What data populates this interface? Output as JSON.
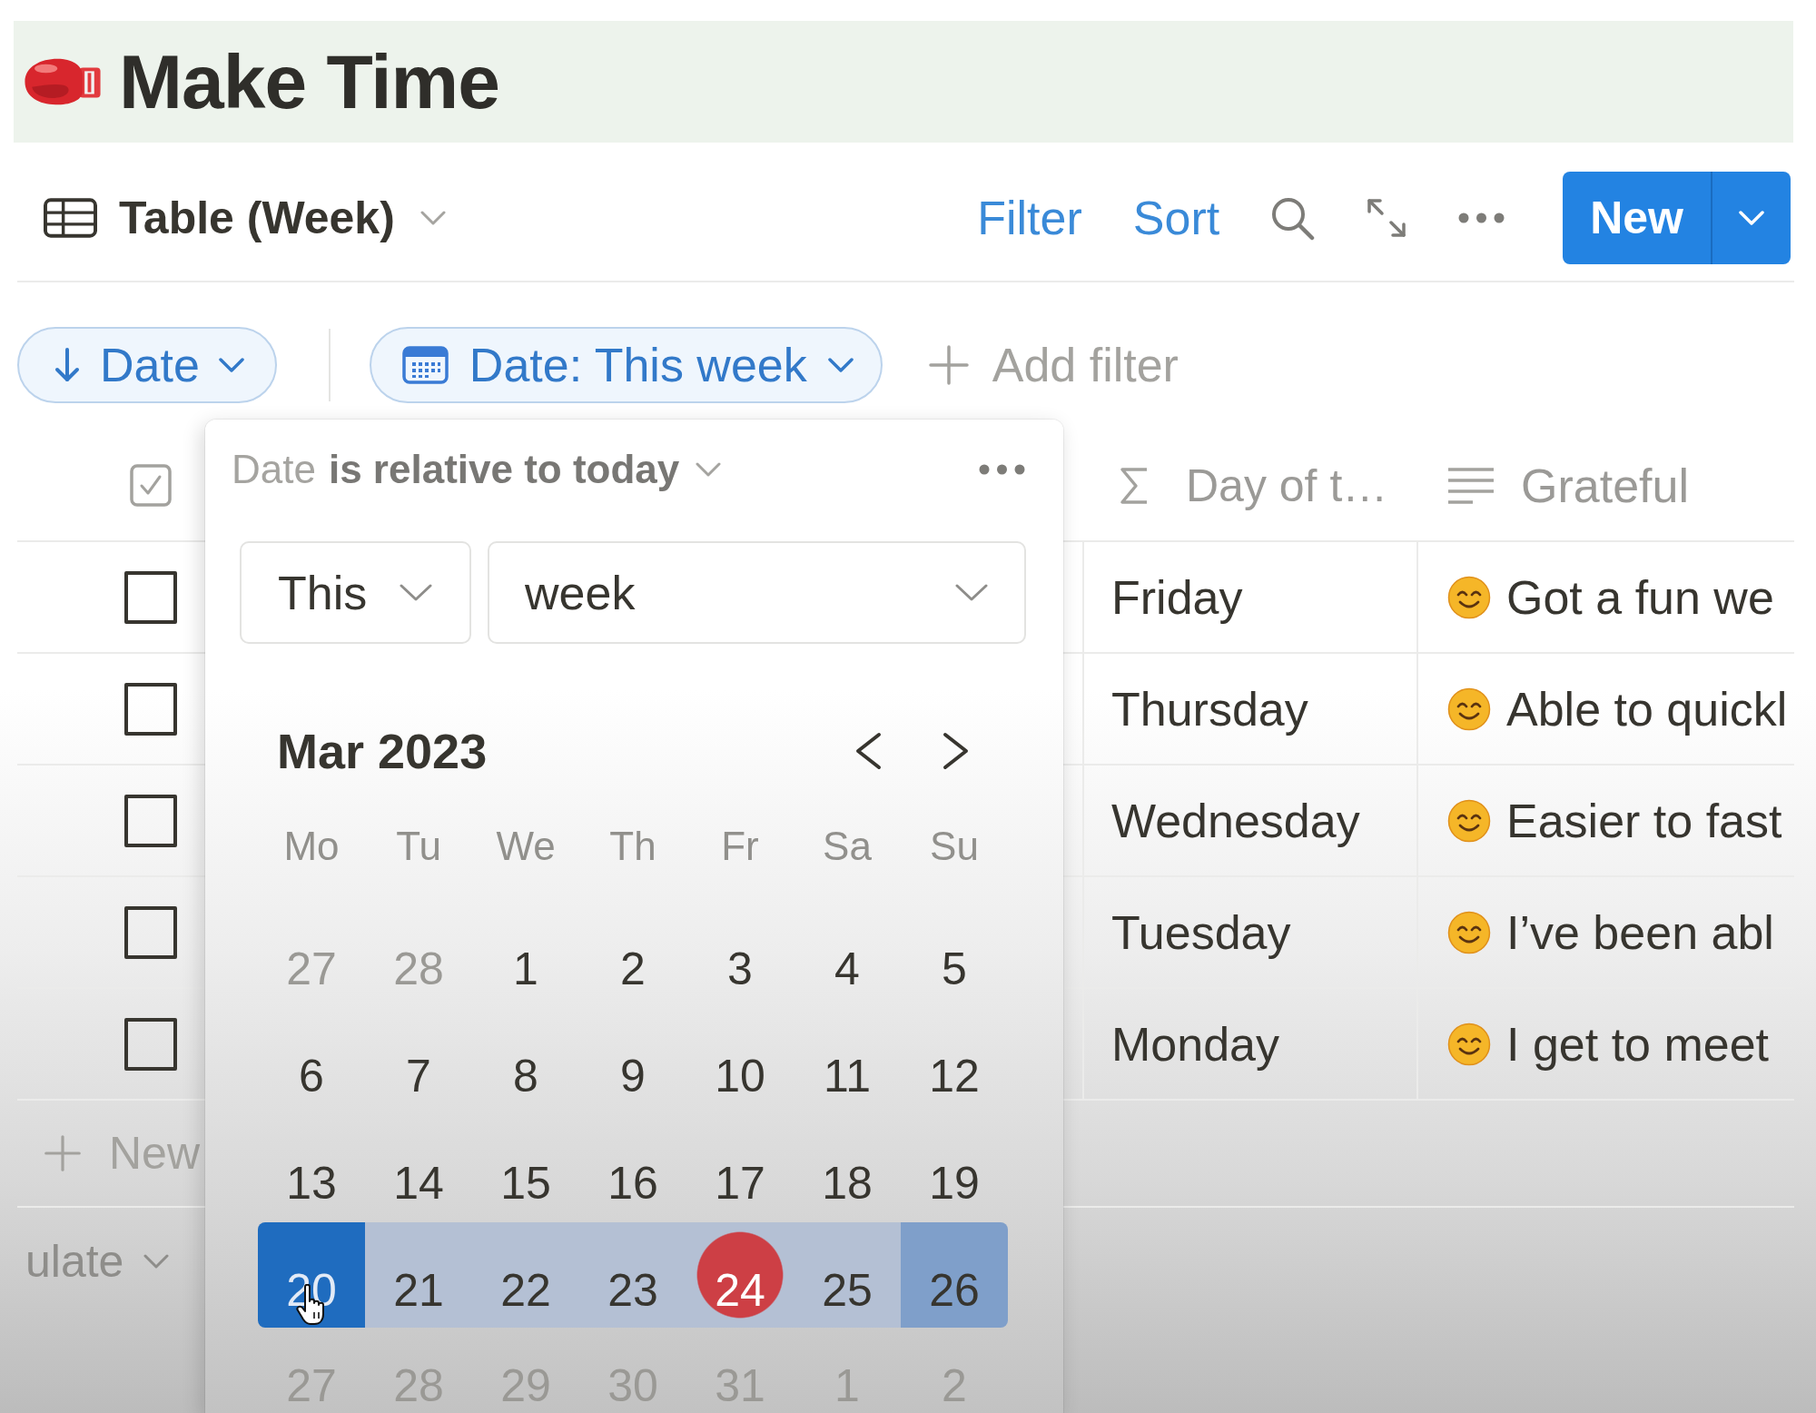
{
  "page": {
    "title": "Make Time"
  },
  "view_bar": {
    "view_name": "Table (Week)",
    "actions": [
      {
        "label": "Filter"
      },
      {
        "label": "Sort"
      }
    ],
    "new_button": "New"
  },
  "filter_bar": {
    "sort_pill": "Date",
    "filter_pill": "Date: This week",
    "add_filter": "Add filter"
  },
  "table": {
    "columns": [
      {
        "kind": "checkbox"
      },
      {
        "kind": "formula",
        "label": "Day of t…"
      },
      {
        "kind": "text",
        "label": "Grateful"
      }
    ],
    "rows": [
      {
        "checked": false,
        "day": "Friday",
        "grateful": "Got a fun we"
      },
      {
        "checked": false,
        "day": "Thursday",
        "grateful": "Able to quickl"
      },
      {
        "checked": false,
        "day": "Wednesday",
        "grateful": "Easier to fast"
      },
      {
        "checked": false,
        "day": "Tuesday",
        "grateful": "I’ve been abl"
      },
      {
        "checked": false,
        "day": "Monday",
        "grateful": "I get to meet"
      }
    ],
    "new_row": "New",
    "calculate": "ulate"
  },
  "filter_popup": {
    "property": "Date",
    "condition": "is relative to today",
    "relation": "This",
    "unit": "week",
    "calendar": {
      "month": "Mar 2023",
      "weekdays": [
        "Mo",
        "Tu",
        "We",
        "Th",
        "Fr",
        "Sa",
        "Su"
      ],
      "weeks": [
        {
          "days": [
            {
              "label": "27",
              "muted": true,
              "selected": false,
              "today": false,
              "hovered": false
            },
            {
              "label": "28",
              "muted": true,
              "selected": false,
              "today": false,
              "hovered": false
            },
            {
              "label": "1",
              "muted": false,
              "selected": false,
              "today": false,
              "hovered": false
            },
            {
              "label": "2",
              "muted": false,
              "selected": false,
              "today": false,
              "hovered": false
            },
            {
              "label": "3",
              "muted": false,
              "selected": false,
              "today": false,
              "hovered": false
            },
            {
              "label": "4",
              "muted": false,
              "selected": false,
              "today": false,
              "hovered": false
            },
            {
              "label": "5",
              "muted": false,
              "selected": false,
              "today": false,
              "hovered": false
            }
          ]
        },
        {
          "days": [
            {
              "label": "6",
              "muted": false,
              "selected": false,
              "today": false,
              "hovered": false
            },
            {
              "label": "7",
              "muted": false,
              "selected": false,
              "today": false,
              "hovered": false
            },
            {
              "label": "8",
              "muted": false,
              "selected": false,
              "today": false,
              "hovered": false
            },
            {
              "label": "9",
              "muted": false,
              "selected": false,
              "today": false,
              "hovered": false
            },
            {
              "label": "10",
              "muted": false,
              "selected": false,
              "today": false,
              "hovered": false
            },
            {
              "label": "11",
              "muted": false,
              "selected": false,
              "today": false,
              "hovered": false
            },
            {
              "label": "12",
              "muted": false,
              "selected": false,
              "today": false,
              "hovered": false
            }
          ]
        },
        {
          "days": [
            {
              "label": "13",
              "muted": false,
              "selected": false,
              "today": false,
              "hovered": false
            },
            {
              "label": "14",
              "muted": false,
              "selected": false,
              "today": false,
              "hovered": false
            },
            {
              "label": "15",
              "muted": false,
              "selected": false,
              "today": false,
              "hovered": false
            },
            {
              "label": "16",
              "muted": false,
              "selected": false,
              "today": false,
              "hovered": false
            },
            {
              "label": "17",
              "muted": false,
              "selected": false,
              "today": false,
              "hovered": false
            },
            {
              "label": "18",
              "muted": false,
              "selected": false,
              "today": false,
              "hovered": false
            },
            {
              "label": "19",
              "muted": false,
              "selected": false,
              "today": false,
              "hovered": false
            }
          ]
        },
        {
          "days": [
            {
              "label": "20",
              "muted": false,
              "selected": true,
              "today": false,
              "hovered": true
            },
            {
              "label": "21",
              "muted": false,
              "selected": true,
              "today": false,
              "hovered": false
            },
            {
              "label": "22",
              "muted": false,
              "selected": true,
              "today": false,
              "hovered": false
            },
            {
              "label": "23",
              "muted": false,
              "selected": true,
              "today": false,
              "hovered": false
            },
            {
              "label": "24",
              "muted": false,
              "selected": true,
              "today": true,
              "hovered": false
            },
            {
              "label": "25",
              "muted": false,
              "selected": true,
              "today": false,
              "hovered": false
            },
            {
              "label": "26",
              "muted": false,
              "selected": true,
              "today": false,
              "hovered": false
            }
          ]
        },
        {
          "days": [
            {
              "label": "27",
              "muted": true,
              "selected": false,
              "today": false,
              "hovered": false
            },
            {
              "label": "28",
              "muted": true,
              "selected": false,
              "today": false,
              "hovered": false
            },
            {
              "label": "29",
              "muted": true,
              "selected": false,
              "today": false,
              "hovered": false
            },
            {
              "label": "30",
              "muted": true,
              "selected": false,
              "today": false,
              "hovered": false
            },
            {
              "label": "31",
              "muted": true,
              "selected": false,
              "today": false,
              "hovered": false
            },
            {
              "label": "1",
              "muted": true,
              "selected": false,
              "today": false,
              "hovered": false
            },
            {
              "label": "2",
              "muted": true,
              "selected": false,
              "today": false,
              "hovered": false
            }
          ]
        }
      ]
    }
  }
}
